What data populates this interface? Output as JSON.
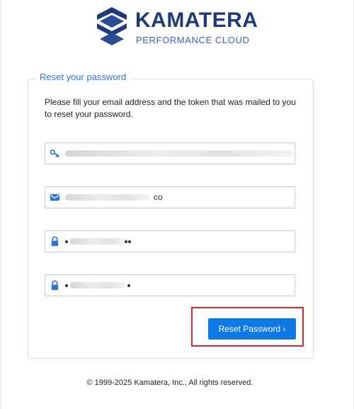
{
  "brand": {
    "name": "KAMATERA",
    "tagline": "PERFORMANCE CLOUD",
    "primary_color": "#1e3a7a",
    "accent_color": "#3a5fb0"
  },
  "form": {
    "legend": "Reset your password",
    "instructions": "Please fill your email address and the token that was mailed to you to reset your password.",
    "token": {
      "icon": "key-icon",
      "value": ""
    },
    "email": {
      "icon": "envelope-icon",
      "value_suffix": "co"
    },
    "password": {
      "icon": "lock-icon"
    },
    "confirm_password": {
      "icon": "lock-icon"
    },
    "submit_label": "Reset Password ›",
    "submit_color": "#0d7ae4",
    "highlight_color": "#d9262b"
  },
  "footer": {
    "copyright": "© 1999-2025 Kamatera, Inc., All rights reserved."
  }
}
